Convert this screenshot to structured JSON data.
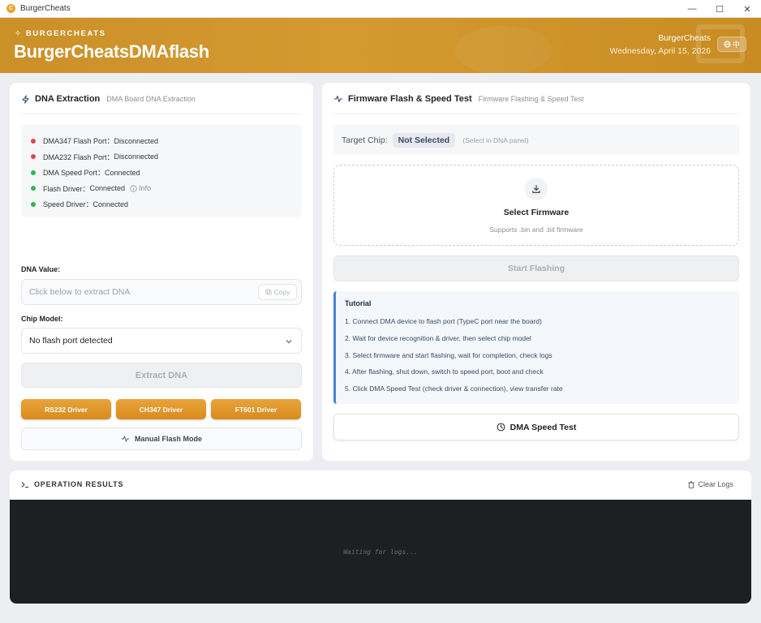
{
  "window": {
    "title": "BurgerCheats",
    "icon_letter": "C",
    "controls": {
      "minimize": "—",
      "maximize": "☐",
      "close": "✕"
    }
  },
  "header": {
    "brand_small": "BURGERCHEATS",
    "brand_small_glyph": "✧",
    "app_name": "BurgerCheatsDMAflash",
    "user": "BurgerCheats",
    "date": "Wednesday, April 15, 2026",
    "lang_label": "中",
    "accent_color": "#cb9028"
  },
  "dna_panel": {
    "title": "DNA Extraction",
    "subtitle": "DMA Board DNA Extraction",
    "statuses": [
      {
        "label": "DMA347 Flash Port：",
        "value": "Disconnected",
        "state": "red"
      },
      {
        "label": "DMA232 Flash Port：",
        "value": "Disconnected",
        "state": "red"
      },
      {
        "label": "DMA Speed Port：",
        "value": "Connected",
        "state": "green"
      },
      {
        "label": "Flash Driver：",
        "value": "Connected",
        "state": "green",
        "extra": "Info"
      },
      {
        "label": "Speed Driver：",
        "value": "Connected",
        "state": "green"
      }
    ],
    "dna_label": "DNA Value:",
    "dna_placeholder": "Click below to extract DNA",
    "copy_label": "Copy",
    "chip_label": "Chip Model:",
    "chip_value": "No flash port detected",
    "extract_label": "Extract DNA",
    "drivers": [
      "RS232 Driver",
      "CH347 Driver",
      "FT601 Driver"
    ],
    "manual_label": "Manual Flash Mode"
  },
  "flash_panel": {
    "title": "Firmware Flash & Speed Test",
    "subtitle": "Firmware Flashing & Speed Test",
    "target_label": "Target Chip:",
    "target_value": "Not Selected",
    "target_hint": "(Select in DNA panel)",
    "firmware_title": "Select Firmware",
    "firmware_sub": "Supports .bin and .bit firmware",
    "flash_label": "Start Flashing",
    "tutorial_title": "Tutorial",
    "tutorial_steps": [
      "1. Connect DMA device to flash port (TypeC port near the board)",
      "2. Wait for device recognition & driver, then select chip model",
      "3. Select firmware and start flashing, wait for completion, check logs",
      "4. After flashing, shut down, switch to speed port, boot and check",
      "5. Click DMA Speed Test (check driver & connection), view transfer rate"
    ],
    "speed_label": "DMA Speed Test"
  },
  "results": {
    "title": "OPERATION RESULTS",
    "clear_label": "Clear Logs",
    "waiting": "Waiting for logs..."
  }
}
